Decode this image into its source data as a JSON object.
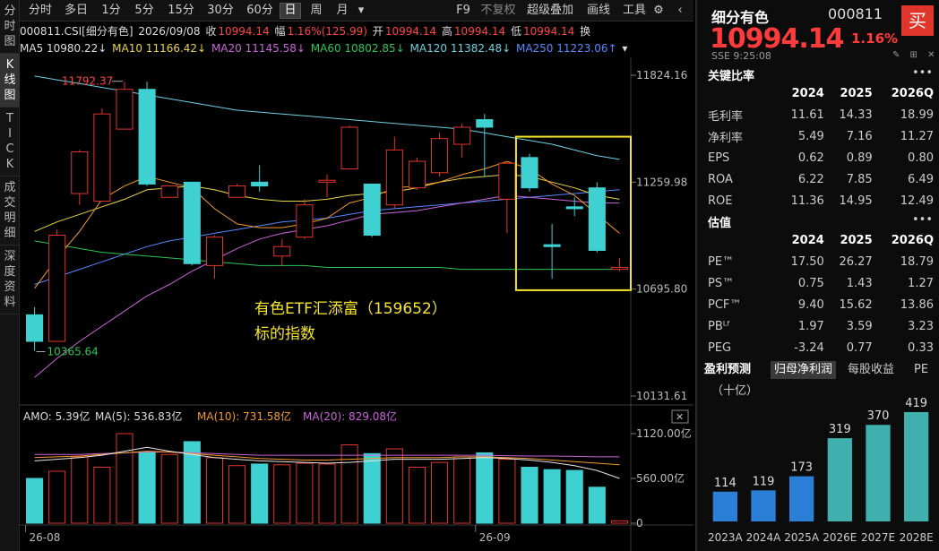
{
  "left_tabs": [
    "分时图",
    "K线图",
    "TICK",
    "成交明细",
    "深度资料"
  ],
  "toolbar": {
    "items": [
      "分时",
      "多日",
      "1分",
      "5分",
      "15分",
      "30分",
      "60分",
      "日",
      "周",
      "月",
      "▾"
    ],
    "active": "日",
    "right_items": [
      "F9",
      "不复权",
      "超级叠加",
      "画线",
      "工具"
    ],
    "gear": "⚙",
    "collapse": "‹"
  },
  "info": {
    "code_name": "000811.CSI[细分有色]",
    "date": "2026/09/08",
    "close_label": "收",
    "close": "10994.14",
    "amp_label": "幅",
    "amp": "1.16%(125.99)",
    "open_label": "开",
    "open": "10994.14",
    "high_label": "高",
    "high": "10994.14",
    "low_label": "低",
    "low": "10994.14",
    "more": "换"
  },
  "ma": {
    "ma5": "MA5 10980.22↓",
    "ma10": "MA10 11166.42↓",
    "ma20": "MA20 11145.58↓",
    "ma60": "MA60 10802.85↓",
    "ma120": "MA120 11382.48↓",
    "ma250": "MA250 11223.06↑",
    "extra": "▾"
  },
  "colors": {
    "up": "#e0352b",
    "down": "#3fd0d2",
    "ma5": "#f39a2c",
    "ma10": "#e8d44a",
    "ma20": "#c965d8",
    "ma60": "#2ec456",
    "ma120": "#6fd0e0",
    "ma250": "#5b87ff",
    "highlight": "#f5e62c"
  },
  "price_axis": [
    "11824.16",
    "11259.98",
    "10695.80",
    "10131.61"
  ],
  "annotations": {
    "high": "11792.37",
    "low": "10365.64",
    "overlay_line1": "有色ETF汇添富（159652）",
    "overlay_line2": "标的指数"
  },
  "vol_header": {
    "amo": "AMO: 5.39亿",
    "ma5": "MA(5): 536.83亿",
    "ma10": "MA(10): 731.58亿",
    "ma20": "MA(20): 829.08亿"
  },
  "vol_axis": [
    "1120.00亿",
    "560.00亿",
    "0"
  ],
  "date_axis": [
    "26-08",
    "26-09"
  ],
  "chart_data": {
    "type": "candlestick",
    "ohlc": [
      {
        "o": 10560,
        "h": 10600,
        "l": 10370,
        "c": 10420
      },
      {
        "o": 10420,
        "h": 11010,
        "l": 10420,
        "c": 10980
      },
      {
        "o": 11200,
        "h": 11430,
        "l": 11140,
        "c": 11420
      },
      {
        "o": 11160,
        "h": 11650,
        "l": 11160,
        "c": 11620
      },
      {
        "o": 11540,
        "h": 11790,
        "l": 11540,
        "c": 11750
      },
      {
        "o": 11750,
        "h": 11790,
        "l": 11240,
        "c": 11250
      },
      {
        "o": 11180,
        "h": 11240,
        "l": 11180,
        "c": 11240
      },
      {
        "o": 11260,
        "h": 11260,
        "l": 10820,
        "c": 10830
      },
      {
        "o": 10820,
        "h": 10980,
        "l": 10750,
        "c": 10970
      },
      {
        "o": 11180,
        "h": 11250,
        "l": 11180,
        "c": 11240
      },
      {
        "o": 11260,
        "h": 11350,
        "l": 11210,
        "c": 11240
      },
      {
        "o": 10870,
        "h": 10960,
        "l": 10820,
        "c": 10920
      },
      {
        "o": 10970,
        "h": 11170,
        "l": 10960,
        "c": 11140
      },
      {
        "o": 11260,
        "h": 11300,
        "l": 11180,
        "c": 11270
      },
      {
        "o": 11330,
        "h": 11560,
        "l": 11330,
        "c": 11550
      },
      {
        "o": 11250,
        "h": 11250,
        "l": 10970,
        "c": 10980
      },
      {
        "o": 11140,
        "h": 11500,
        "l": 11120,
        "c": 11430
      },
      {
        "o": 11230,
        "h": 11390,
        "l": 11220,
        "c": 11370
      },
      {
        "o": 11310,
        "h": 11520,
        "l": 11290,
        "c": 11490
      },
      {
        "o": 11460,
        "h": 11570,
        "l": 11390,
        "c": 11550
      },
      {
        "o": 11590,
        "h": 11620,
        "l": 11290,
        "c": 11550
      },
      {
        "o": 11170,
        "h": 11370,
        "l": 10990,
        "c": 11360
      },
      {
        "o": 11390,
        "h": 11410,
        "l": 11210,
        "c": 11230
      },
      {
        "o": 10930,
        "h": 11040,
        "l": 10750,
        "c": 10920
      },
      {
        "o": 11130,
        "h": 11180,
        "l": 11080,
        "c": 11120
      },
      {
        "o": 11230,
        "h": 11260,
        "l": 10890,
        "c": 10900
      },
      {
        "o": 10800,
        "h": 10860,
        "l": 10790,
        "c": 10810
      }
    ],
    "ma5": [
      10700,
      10860,
      11000,
      11170,
      11240,
      11290,
      11260,
      11230,
      11120,
      11040,
      11020,
      11020,
      11040,
      11070,
      11150,
      11180,
      11230,
      11240,
      11260,
      11300,
      11330,
      11370,
      11330,
      11250,
      11190,
      11090,
      10990
    ],
    "ma10": [
      11000,
      11050,
      11090,
      11130,
      11170,
      11220,
      11230,
      11240,
      11220,
      11190,
      11170,
      11160,
      11160,
      11170,
      11190,
      11200,
      11210,
      11230,
      11260,
      11280,
      11290,
      11300,
      11290,
      11260,
      11230,
      11190,
      11170
    ],
    "ma20": [
      10230,
      10330,
      10420,
      10500,
      10580,
      10660,
      10720,
      10790,
      10850,
      10910,
      10960,
      10990,
      11010,
      11030,
      11060,
      11090,
      11100,
      11110,
      11130,
      11150,
      11170,
      11190,
      11180,
      11170,
      11160,
      11150,
      11150
    ],
    "ma60": [
      10950,
      10930,
      10910,
      10890,
      10880,
      10870,
      10860,
      10850,
      10840,
      10830,
      10820,
      10820,
      10820,
      10810,
      10810,
      10810,
      10810,
      10810,
      10810,
      10800,
      10800,
      10800,
      10800,
      10800,
      10800,
      10800,
      10800
    ],
    "ma120": [
      11820,
      11800,
      11780,
      11760,
      11740,
      11720,
      11700,
      11680,
      11660,
      11640,
      11630,
      11620,
      11610,
      11600,
      11590,
      11580,
      11570,
      11560,
      11550,
      11540,
      11520,
      11500,
      11480,
      11460,
      11430,
      11400,
      11380
    ],
    "ma250": [
      10720,
      10760,
      10800,
      10840,
      10880,
      10920,
      10950,
      10970,
      10990,
      11010,
      11030,
      11050,
      11060,
      11070,
      11090,
      11110,
      11120,
      11130,
      11140,
      11150,
      11160,
      11170,
      11180,
      11190,
      11200,
      11210,
      11220
    ],
    "volume": [
      560,
      650,
      830,
      700,
      1120,
      880,
      860,
      1020,
      820,
      720,
      740,
      730,
      750,
      740,
      980,
      870,
      930,
      700,
      760,
      830,
      880,
      800,
      700,
      670,
      660,
      450,
      30
    ],
    "vol_ma5": [
      780,
      800,
      820,
      850,
      900,
      950,
      900,
      860,
      820,
      800,
      780,
      770,
      760,
      750,
      760,
      780,
      800,
      800,
      800,
      810,
      820,
      810,
      790,
      760,
      720,
      660,
      560
    ],
    "vol_ma10": [
      820,
      830,
      840,
      860,
      880,
      900,
      890,
      870,
      850,
      830,
      810,
      800,
      790,
      790,
      800,
      810,
      820,
      820,
      820,
      830,
      830,
      820,
      810,
      790,
      770,
      750,
      730
    ],
    "vol_ma20": [
      860,
      860,
      860,
      870,
      880,
      890,
      890,
      880,
      870,
      860,
      850,
      850,
      850,
      850,
      850,
      850,
      850,
      850,
      850,
      850,
      850,
      845,
      840,
      840,
      835,
      830,
      830
    ],
    "y_range": [
      10131.61,
      11824.16
    ],
    "vol_range": [
      0,
      1120
    ]
  },
  "quote": {
    "name": "细分有色",
    "code": "000811",
    "buy": "买",
    "price": "10994.14",
    "pct": "1.16%",
    "time": "SSE  9:25:08",
    "icons": "✎ ⊞ ✕"
  },
  "key_ratios": {
    "title": "关键比率",
    "more": "•••",
    "years": [
      "2024",
      "2025",
      "2026Q"
    ],
    "rows": [
      {
        "label": "毛利率",
        "v": [
          "11.61",
          "14.33",
          "18.99"
        ]
      },
      {
        "label": "净利率",
        "v": [
          "5.49",
          "7.16",
          "11.27"
        ]
      },
      {
        "label": "EPS",
        "v": [
          "0.62",
          "0.89",
          "0.80"
        ]
      },
      {
        "label": "ROA",
        "v": [
          "6.22",
          "7.85",
          "6.49"
        ]
      },
      {
        "label": "ROE",
        "v": [
          "11.36",
          "14.95",
          "12.49"
        ]
      }
    ]
  },
  "valuation": {
    "title": "估值",
    "more": "•••",
    "years": [
      "2024",
      "2025",
      "2026Q"
    ],
    "rows": [
      {
        "label": "PE™",
        "v": [
          "17.50",
          "26.27",
          "18.79"
        ]
      },
      {
        "label": "PS™",
        "v": [
          "0.75",
          "1.43",
          "1.27"
        ]
      },
      {
        "label": "PCF™",
        "v": [
          "9.40",
          "15.62",
          "13.86"
        ]
      },
      {
        "label": "PBᴸᶠ",
        "v": [
          "1.97",
          "3.59",
          "3.23"
        ]
      },
      {
        "label": "PEG",
        "v": [
          "-3.24",
          "0.77",
          "0.33"
        ]
      }
    ]
  },
  "forecast": {
    "tabs": [
      "盈利预测",
      "归母净利润",
      "每股收益",
      "PE"
    ],
    "active": "归母净利润",
    "unit": "（十亿）",
    "chart_data": {
      "type": "bar",
      "categories": [
        "2023A",
        "2024A",
        "2025A",
        "2026E",
        "2027E",
        "2028E"
      ],
      "values": [
        114,
        119,
        173,
        319,
        370,
        419
      ],
      "colors": [
        "#2b7fd6",
        "#2b7fd6",
        "#2b7fd6",
        "#3fb0ad",
        "#3fb0ad",
        "#3fb0ad"
      ]
    }
  }
}
